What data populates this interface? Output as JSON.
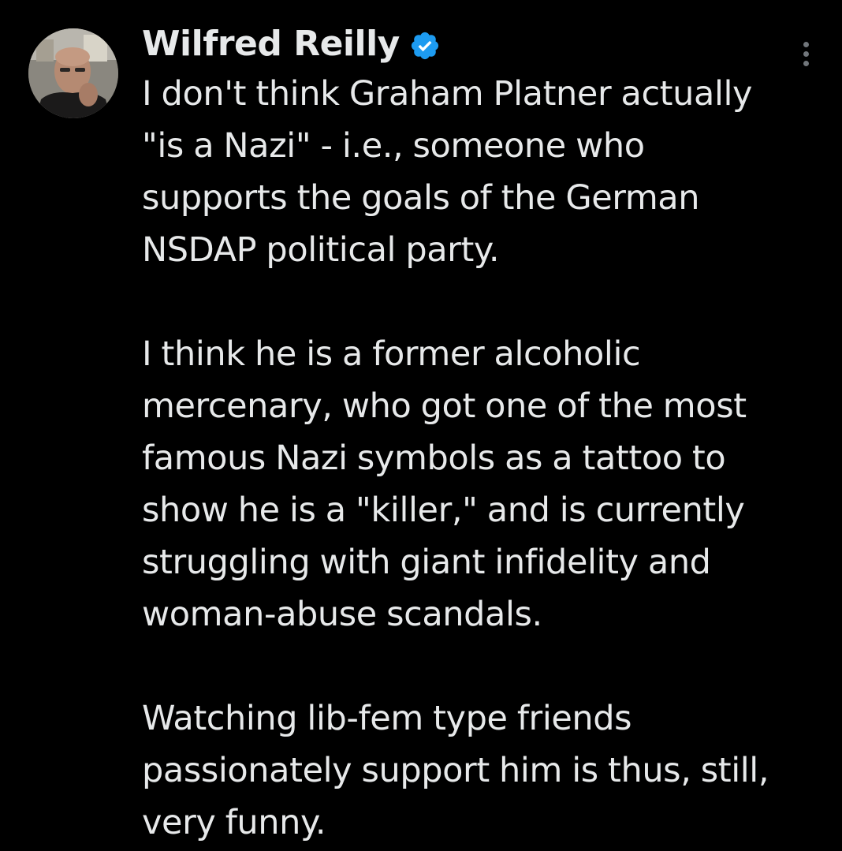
{
  "tweet": {
    "author": {
      "display_name": "Wilfred Reilly",
      "avatar_icon": "profile-photo",
      "verified_icon": "verified-badge-icon",
      "verified_color": "#1d9bf0"
    },
    "more_icon": "more-options-icon",
    "paragraphs": [
      [
        "I don't think Graham Platner actually",
        "\"is a Nazi\" - i.e., someone who",
        "supports the goals of the German",
        "NSDAP political party."
      ],
      [
        "I think he is a former alcoholic",
        "mercenary, who got one of the most",
        "famous Nazi symbols as a tattoo to",
        "show he is a \"killer,\" and is currently",
        "struggling with giant infidelity and",
        "woman-abuse scandals."
      ],
      [
        "Watching lib-fem type friends",
        "passionately support him is thus, still,",
        "very funny."
      ]
    ]
  },
  "colors": {
    "background": "#000000",
    "text": "#e7e9ea",
    "secondary": "#71767b",
    "accent": "#1d9bf0"
  }
}
